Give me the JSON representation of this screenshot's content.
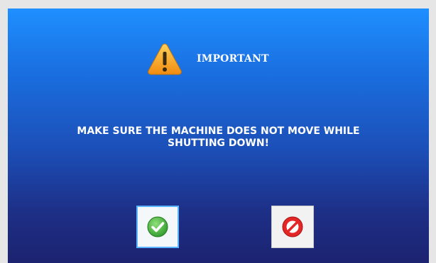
{
  "dialog": {
    "title": "IMPORTANT",
    "message_line1": "MAKE SURE THE MACHINE DOES NOT MOVE WHILE",
    "message_line2": "SHUTTING DOWN!",
    "icons": {
      "header": "warning-icon",
      "confirm": "check-icon",
      "cancel": "prohibited-icon"
    },
    "colors": {
      "background_top": "#1f8fff",
      "background_bottom": "#1c2370",
      "text": "#ffffff",
      "warning": "#f5a623",
      "confirm": "#3cb043",
      "cancel": "#e02020"
    }
  }
}
